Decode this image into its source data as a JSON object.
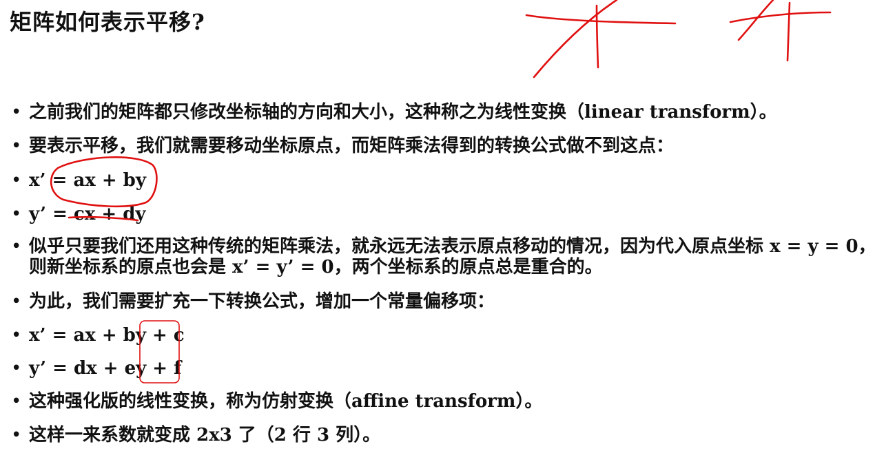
{
  "slide": {
    "title": "矩阵如何表示平移?",
    "bullet_marker": "•",
    "bullets": [
      {
        "text": "之前我们的矩阵都只修改坐标轴的方向和大小，这种称之为线性变换（linear transform）。"
      },
      {
        "text": "要表示平移，我们就需要移动坐标原点，而矩阵乘法得到的转换公式做不到这点："
      },
      {
        "text": "x’ = ax + by"
      },
      {
        "text": "y’ = cx + dy"
      },
      {
        "text": "似乎只要我们还用这种传统的矩阵乘法，就永远无法表示原点移动的情况，因为代入原点坐标 x = y = 0，则新坐标系的原点也会是 x’ = y’ = 0，两个坐标系的原点总是重合的。"
      },
      {
        "text": "为此，我们需要扩充一下转换公式，增加一个常量偏移项："
      },
      {
        "text": "x’ = ax + by + c"
      },
      {
        "text": "y’ = dx + ey + f"
      },
      {
        "text": "这种强化版的线性变换，称为仿射变换（affine transform）。"
      },
      {
        "text": "这样一来系数就变成 2x3 了（2 行 3 列）。"
      }
    ]
  },
  "annotations": {
    "ink_color": "#e01010"
  }
}
